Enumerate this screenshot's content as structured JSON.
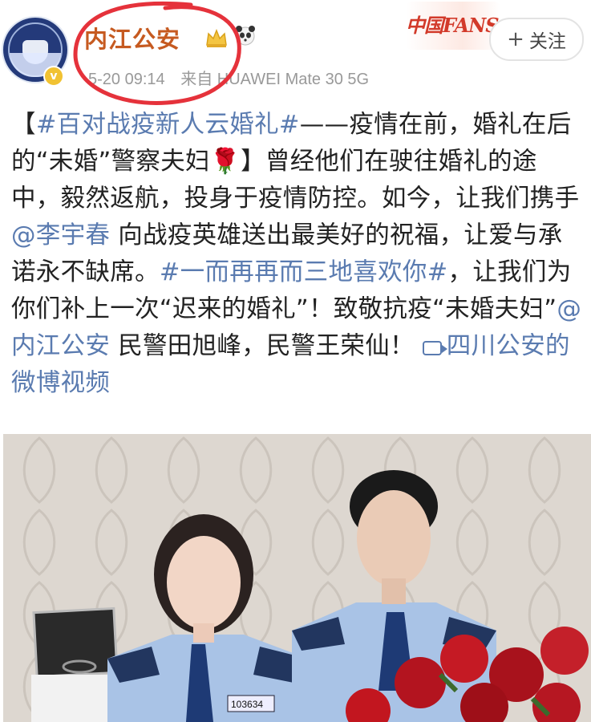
{
  "account": {
    "name": "内江公安",
    "time": "5-20 09:14",
    "source": "来自 HUAWEI Mate 30 5G",
    "fans_badge": "中国FANS",
    "follow_label": "关注",
    "verified_mark": "v"
  },
  "post": {
    "segments": {
      "s1": "【",
      "s2": "#百对战疫新人云婚礼#",
      "s3": "——疫情在前，婚礼在后的“未婚”警察夫妇",
      "s4": "🌹",
      "s5": "】曾经他们在驶往婚礼的途中，毅然返航，投身于疫情防控。如今，让我们携手",
      "s6": "@李宇春",
      "s7": " 向战疫英雄送出最美好的祝福，让爱与承诺永不缺席。",
      "s8": "#一而再再而三地喜欢你#",
      "s9": "，让我们为你们补上一次“迟来的婚礼”！致敬抗疫“未婚夫妇”",
      "s10": "@内江公安",
      "s11": " 民警田旭峰，民警王荣仙！ ",
      "s12": "四川公安的微博视频"
    }
  },
  "video": {
    "badge_number": "103634"
  },
  "colors": {
    "account_name": "#c65a20",
    "link": "#5a7bb0",
    "annotation": "#e5323b"
  }
}
